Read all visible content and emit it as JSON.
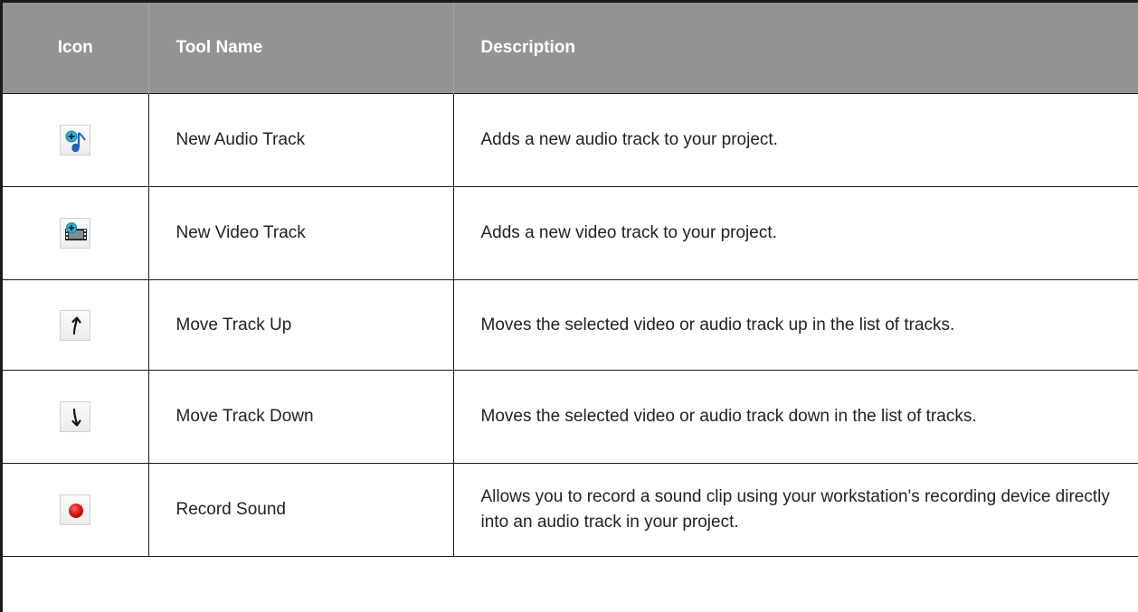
{
  "table": {
    "headers": {
      "icon": "Icon",
      "tool_name": "Tool Name",
      "description": "Description"
    },
    "rows": [
      {
        "icon": "new-audio-track-icon",
        "name": "New Audio Track",
        "description": "Adds a new audio track to your project."
      },
      {
        "icon": "new-video-track-icon",
        "name": "New Video Track",
        "description": "Adds a new video track to your project."
      },
      {
        "icon": "move-track-up-icon",
        "name": "Move Track Up",
        "description": "Moves the selected video or audio track up in the list of tracks."
      },
      {
        "icon": "move-track-down-icon",
        "name": "Move Track Down",
        "description": "Moves the selected video or audio track down in the list of tracks."
      },
      {
        "icon": "record-sound-icon",
        "name": "Record Sound",
        "description": "Allows you to record a sound clip using your workstation's recording device directly into an audio track in your project."
      }
    ]
  },
  "colors": {
    "header_bg": "#939393",
    "header_text": "#ffffff",
    "border": "#1a1a1a",
    "accent_cyan": "#2ab8d8",
    "accent_blue": "#1f5fbf",
    "record_red": "#e01b1b"
  }
}
